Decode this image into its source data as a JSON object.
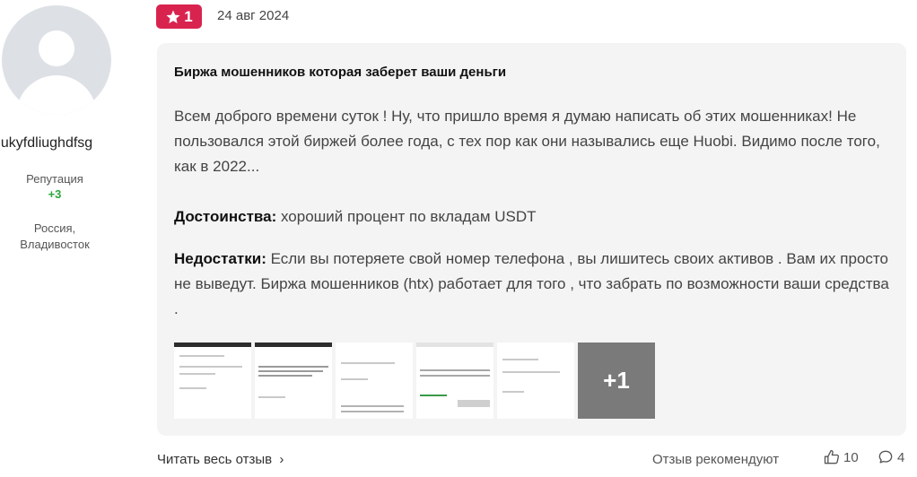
{
  "author": {
    "username": "gukyfdliughdfsg",
    "reputation_label": "Репутация",
    "reputation_value": "+3",
    "location_line1": "Россия,",
    "location_line2": "Владивосток"
  },
  "review": {
    "rating": "1",
    "date": "24 авг 2024",
    "title": "Биржа мошенников которая заберет ваши деньги",
    "text": "Всем доброго времени суток ! Ну, что пришло время я думаю написать об этих мошенниках! Не пользовался этой биржей более года, с тех пор как они назывались еще Huobi. Видимо после того, как в 2022...",
    "pros_label": "Достоинства:",
    "pros_text": "хороший процент по вкладам USDT",
    "cons_label": "Недостатки:",
    "cons_text": "Если вы потеряете свой номер телефона , вы лишитесь своих активов . Вам их просто не выведут. Биржа мошенников (htx) работает для того , что забрать по возможности ваши средства .",
    "more_photos": "+1"
  },
  "footer": {
    "read_more": "Читать весь отзыв",
    "recommend_label": "Отзыв рекомендуют",
    "likes": "10",
    "comments": "4"
  },
  "colors": {
    "rating_badge": "#d9234f",
    "reputation": "#2aa63a",
    "card_bg": "#f4f4f4"
  }
}
